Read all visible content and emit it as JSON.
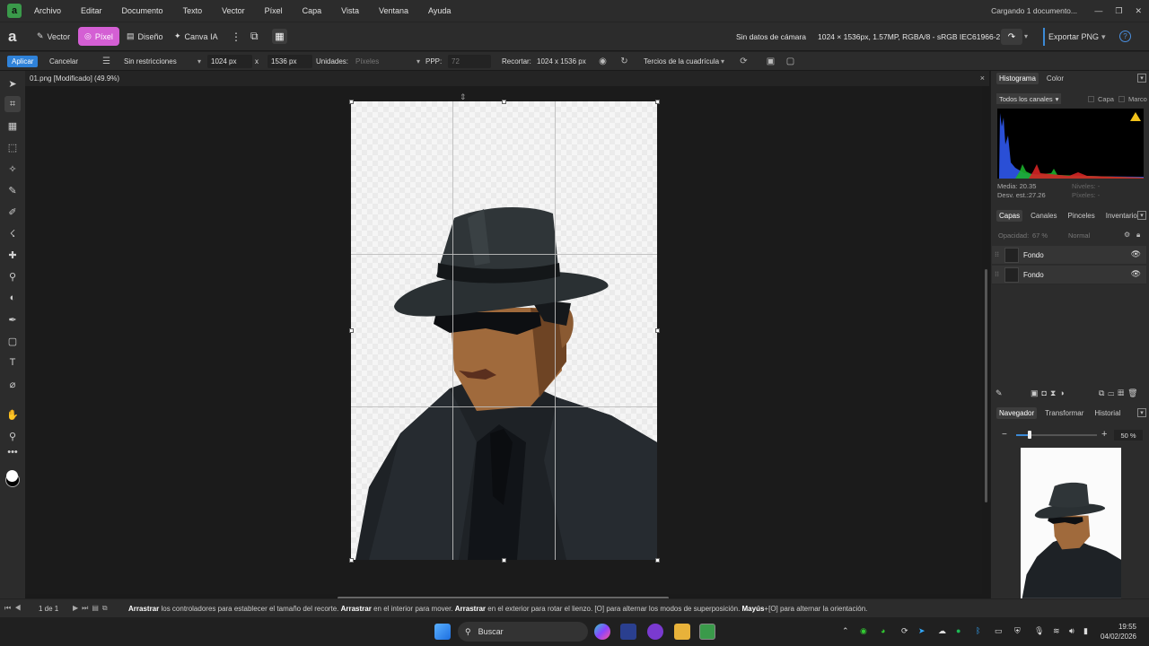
{
  "menubar": {
    "logo": "a",
    "items": [
      "Archivo",
      "Editar",
      "Documento",
      "Texto",
      "Vector",
      "Píxel",
      "Capa",
      "Vista",
      "Ventana",
      "Ayuda"
    ],
    "status": "Cargando 1 documento..."
  },
  "toolbar": {
    "personas": [
      "Vector",
      "Píxel",
      "Diseño",
      "Canva IA"
    ],
    "camera": "Sin datos de cámara",
    "docinfo": "1024 × 1536px, 1.57MP, RGBA/8 - sRGB IEC61966-2.1",
    "export": "Exportar PNG",
    "help": "?"
  },
  "context": {
    "apply": "Aplicar",
    "cancel": "Cancelar",
    "constraint": "Sin restricciones",
    "width": "1024 px",
    "times": "x",
    "height": "1536 px",
    "units_label": "Unidades:",
    "units_value": "Píxeles",
    "ppp_label": "PPP:",
    "ppp_value": "72",
    "crop_label": "Recortar:",
    "crop_value": "1024 x 1536 px",
    "overlay": "Tercios de la cuadrícula"
  },
  "document": {
    "tab": "01.png [Modificado] (49.9%)",
    "close": "×"
  },
  "panels": {
    "histogram_tabs": [
      "Histograma",
      "Color"
    ],
    "channels": "Todos los canales",
    "capa": "Capa",
    "marco": "Marco",
    "media": "Media: 20.35",
    "desv": "Desv. est.:27.26",
    "niveles": "Niveles: -",
    "pixeles": "Píxeles: -",
    "layers_tabs": [
      "Capas",
      "Canales",
      "Pinceles",
      "Inventario"
    ],
    "opacity_label": "Opacidad:",
    "opacity_value": "67 %",
    "blend": "Normal",
    "layers": [
      {
        "name": "Fondo"
      },
      {
        "name": "Fondo"
      }
    ],
    "nav_tabs": [
      "Navegador",
      "Transformar",
      "Historial"
    ],
    "zoom": "50 %"
  },
  "statusbar": {
    "page": "1 de 1",
    "hint_parts": [
      {
        "b": "Arrastrar",
        "t": " los controladores para establecer el tamaño del recorte. "
      },
      {
        "b": "Arrastrar",
        "t": " en el interior para mover. "
      },
      {
        "b": "Arrastrar",
        "t": " en el exterior para rotar el lienzo. [O] para alternar los modos de superposición. "
      },
      {
        "b": "Mayús",
        "t": "+[O] para alternar la orientación."
      }
    ]
  },
  "taskbar": {
    "search": "Buscar",
    "time": "19:55",
    "date": "04/02/2026"
  },
  "colors": {
    "accent_persona": "#d45fd4",
    "apply_blue": "#2f82d9",
    "brand_green": "#3a9a4a"
  }
}
